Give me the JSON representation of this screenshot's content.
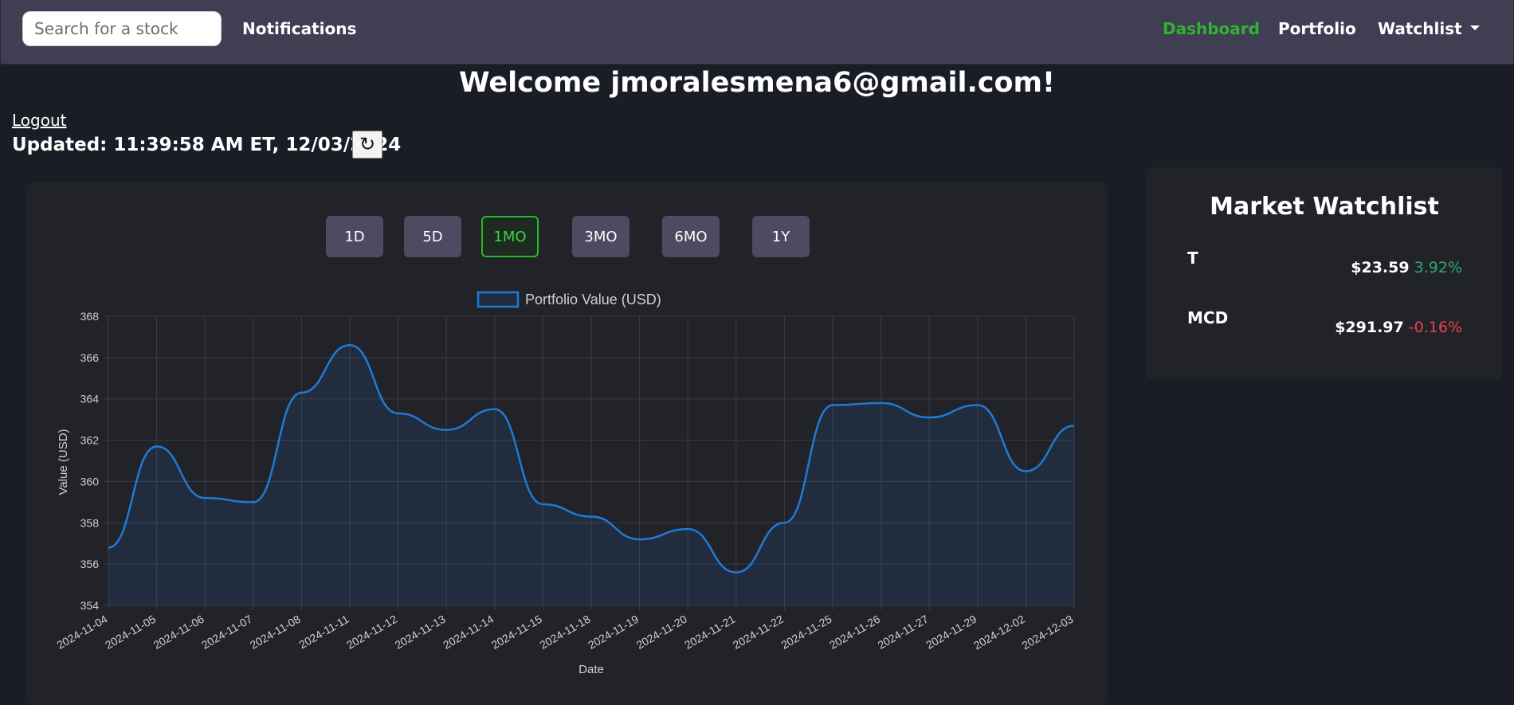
{
  "nav": {
    "search_placeholder": "Search for a stock",
    "notifications": "Notifications",
    "dashboard": "Dashboard",
    "portfolio": "Portfolio",
    "watchlist": "Watchlist"
  },
  "welcome": "Welcome jmoralesmena6@gmail.com!",
  "logout": "Logout",
  "updated": "Updated: 11:39:58 AM ET, 12/03/2024",
  "refresh_icon": "↻",
  "ranges": [
    "1D",
    "5D",
    "1MO",
    "3MO",
    "6MO",
    "1Y"
  ],
  "active_range": "1MO",
  "colors": {
    "accent_green": "#33b233",
    "line_blue": "#1f7ad6",
    "positive": "#2fa86b",
    "negative": "#e8414f"
  },
  "chart_data": {
    "type": "area",
    "legend": "Portfolio Value (USD)",
    "xlabel": "Date",
    "ylabel": "Value (USD)",
    "ylim": [
      354,
      368
    ],
    "yticks": [
      354,
      356,
      358,
      360,
      362,
      364,
      366,
      368
    ],
    "grid": true,
    "legend_position": "top",
    "x": [
      "2024-11-04",
      "2024-11-05",
      "2024-11-06",
      "2024-11-07",
      "2024-11-08",
      "2024-11-11",
      "2024-11-12",
      "2024-11-13",
      "2024-11-14",
      "2024-11-15",
      "2024-11-18",
      "2024-11-19",
      "2024-11-20",
      "2024-11-21",
      "2024-11-22",
      "2024-11-25",
      "2024-11-26",
      "2024-11-27",
      "2024-11-29",
      "2024-12-02",
      "2024-12-03"
    ],
    "series": [
      {
        "name": "Portfolio Value (USD)",
        "values": [
          356.8,
          361.7,
          359.2,
          359.0,
          364.3,
          366.6,
          363.3,
          362.5,
          363.5,
          358.9,
          358.3,
          357.2,
          357.7,
          355.6,
          358.0,
          363.7,
          363.8,
          363.1,
          363.7,
          360.5,
          362.7
        ]
      }
    ]
  },
  "watchlist": {
    "title": "Market Watchlist",
    "items": [
      {
        "symbol": "T",
        "price": "$23.59",
        "change": "3.92%",
        "direction": "up"
      },
      {
        "symbol": "MCD",
        "price": "$291.97",
        "change": "-0.16%",
        "direction": "down"
      }
    ]
  }
}
